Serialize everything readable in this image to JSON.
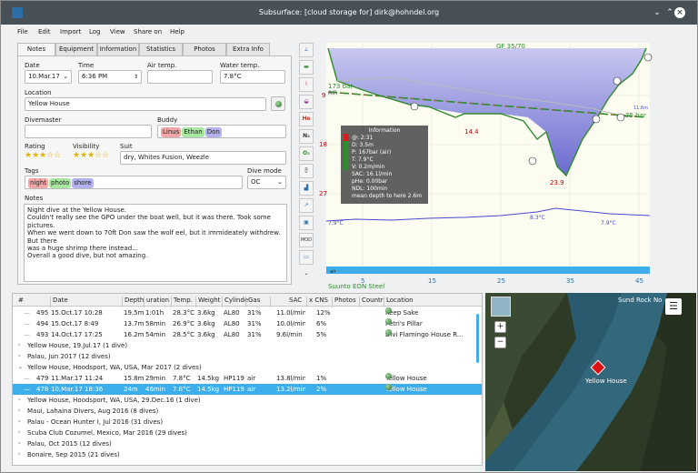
{
  "window": {
    "title": "Subsurface: [cloud storage for] dirk@hohndel.org"
  },
  "menu": [
    "File",
    "Edit",
    "Import",
    "Log",
    "View",
    "Share on",
    "Help"
  ],
  "tabs": [
    "Notes",
    "Equipment",
    "Information",
    "Statistics",
    "Photos",
    "Extra Info"
  ],
  "notes_tab": {
    "date_label": "Date",
    "date_value": "10.Mar.17",
    "time_label": "Time",
    "time_value": "6:36 PM",
    "airtemp_label": "Air temp.",
    "airtemp_value": "",
    "watertemp_label": "Water temp.",
    "watertemp_value": "7.8°C",
    "location_label": "Location",
    "location_value": "Yellow House",
    "divemaster_label": "Divemaster",
    "divemaster_value": "",
    "buddy_label": "Buddy",
    "buddies": [
      {
        "name": "Linus",
        "color": "#f4a6a6"
      },
      {
        "name": "Ethan",
        "color": "#a8e6a1"
      },
      {
        "name": "Don",
        "color": "#b3b1ee"
      }
    ],
    "rating_label": "Rating",
    "rating_stars": "★★★☆☆",
    "visibility_label": "Visibility",
    "visibility_stars": "★★★☆☆",
    "suit_label": "Suit",
    "suit_value": "dry, Whites Fusion, Weezle",
    "tags_label": "Tags",
    "tags": [
      {
        "name": "night",
        "color": "#f4a6a6"
      },
      {
        "name": "photo",
        "color": "#a8e6a1"
      },
      {
        "name": "shore",
        "color": "#b3b1ee"
      }
    ],
    "divemode_label": "Dive mode",
    "divemode_value": "OC",
    "notes_label": "Notes",
    "notes_lines": [
      "Night dive at the Yellow House.",
      "Couldn't really see the GPO under the boat well, but it was there. Took some pictures.",
      "When we went down to 70ft Don saw the wolf eel, but it immideately withdrew. But there",
      "was a huge shrimp there instead...",
      "Overall a good dive, but not amazing."
    ]
  },
  "toolbar_icons": [
    "ruler-icon",
    "heartrate-icon",
    "calculated-ceiling-icon",
    "gas-icon",
    "He",
    "N₂",
    "O₂",
    "mod-icon",
    "tissue-icon",
    "sac-icon",
    "pictures-icon",
    "MOD",
    "tank-bar-icon",
    "chevron-down-icon"
  ],
  "profile": {
    "gf_label": "GF 35/70",
    "pressure_start": "173 bar",
    "air_label": "AIR",
    "pressure_end": "75 bar",
    "depth_labels": [
      "14.4",
      "23.9"
    ],
    "y_ticks": [
      "9",
      "18",
      "27"
    ],
    "temp_labels": [
      "7.9°C",
      "8.3°C",
      "7.9°C"
    ],
    "x_ticks": [
      "5",
      "15",
      "25",
      "35",
      "45"
    ],
    "right_label": "11.6m",
    "computer": "Suunto EON Steel",
    "tank_label": "air",
    "info_box": {
      "title": "Information",
      "lines": [
        "@: 2:31",
        "D: 3.5m",
        "P: 167bar (air)",
        "T: 7.9°C",
        "V: 0.2m/min",
        "SAC: 16.1l/min",
        "pHe: 0.00bar",
        "NDL: 100min",
        "mean depth to here 2.6m"
      ]
    }
  },
  "list": {
    "headers": [
      "#",
      "Date",
      "Depth",
      "uration",
      "Temp.",
      "Weight",
      "Cylinde",
      "Gas",
      "SAC",
      "x CNS",
      "Photos",
      "Countr",
      "Location"
    ],
    "rows": [
      {
        "type": "dive",
        "num": "495",
        "date": "15.Oct.17 10:28",
        "depth": "19.5m",
        "dur": "1:01h",
        "temp": "28.3°C",
        "weight": "3.6kg",
        "cyl": "AL80",
        "gas": "31%",
        "sac": "11.0l/min",
        "cns": "12%",
        "location": "Keep Sake"
      },
      {
        "type": "dive",
        "num": "494",
        "date": "15.Oct.17 8:49",
        "depth": "13.7m",
        "dur": "58min",
        "temp": "26.9°C",
        "weight": "3.6kg",
        "cyl": "AL80",
        "gas": "31%",
        "sac": "10.0l/min",
        "cns": "6%",
        "location": "Petri's Pillar"
      },
      {
        "type": "dive",
        "num": "493",
        "date": "14.Oct.17 17:25",
        "depth": "16.2m",
        "dur": "54min",
        "temp": "28.5°C",
        "weight": "3.6kg",
        "cyl": "AL80",
        "gas": "31%",
        "sac": "9.6l/min",
        "cns": "5%",
        "location": "Divi Flamingo House R..."
      },
      {
        "type": "trip",
        "label": "Yellow House, 19.Jul.17 (1 dive)",
        "open": false
      },
      {
        "type": "trip",
        "label": "Palau, Jun 2017 (12 dives)",
        "open": false
      },
      {
        "type": "trip",
        "label": "Yellow House, Hoodsport, WA, USA, Mar 2017 (2 dives)",
        "open": true
      },
      {
        "type": "dive",
        "num": "479",
        "date": "11.Mar.17 11:24",
        "depth": "15.8m",
        "dur": "29min",
        "temp": "7.8°C",
        "weight": "14.5kg",
        "cyl": "HP119",
        "gas": "air",
        "sac": "13.8l/min",
        "cns": "1%",
        "location": "Yellow House"
      },
      {
        "type": "dive",
        "selected": true,
        "num": "478",
        "date": "10.Mar.17 18:36",
        "depth": "24m",
        "dur": "46min",
        "temp": "7.8°C",
        "weight": "14.5kg",
        "cyl": "HP119",
        "gas": "air",
        "sac": "13.2l/min",
        "cns": "2%",
        "location": "Yellow House"
      },
      {
        "type": "trip",
        "label": "Yellow House, Hoodsport, WA, USA, 29.Dec.16 (1 dive)",
        "open": false
      },
      {
        "type": "trip",
        "label": "Maui, Lahaina Divers, Aug 2016 (8 dives)",
        "open": false
      },
      {
        "type": "trip",
        "label": "Palau - Ocean Hunter I, Jul 2016 (31 dives)",
        "open": false
      },
      {
        "type": "trip",
        "label": "Scuba Club Cozumel, Mexico, Mar 2016 (29 dives)",
        "open": false
      },
      {
        "type": "trip",
        "label": "Palau, Oct 2015 (12 dives)",
        "open": false
      },
      {
        "type": "trip",
        "label": "Bonaire, Sep 2015 (21 dives)",
        "open": false
      }
    ]
  },
  "map": {
    "place_label": "Sund Rock No",
    "marker_label": "Yellow House",
    "zoom_in": "+",
    "zoom_out": "−"
  }
}
